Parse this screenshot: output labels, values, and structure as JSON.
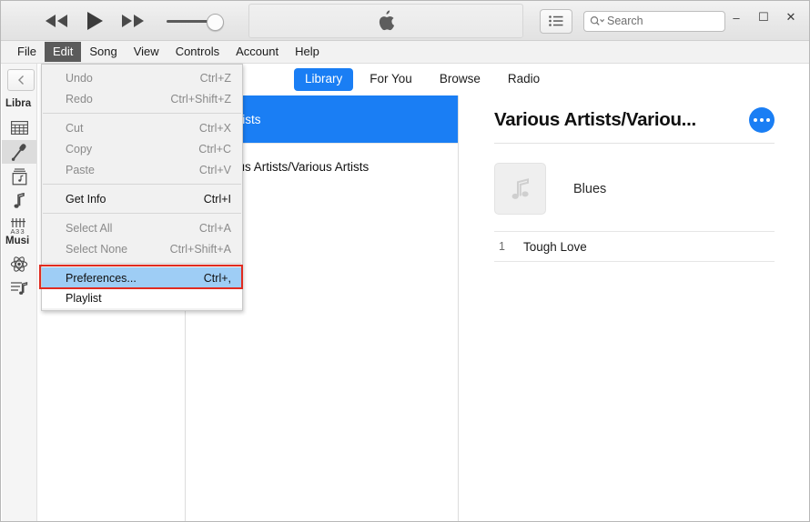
{
  "window": {
    "controls": {
      "minimize": "–",
      "maximize": "☐",
      "close": "✕"
    }
  },
  "toolbar": {
    "previous_icon": "rewind-icon",
    "play_icon": "play-icon",
    "next_icon": "fast-forward-icon",
    "volume_icon": "volume-slider",
    "airplay_icon": "airplay-icon",
    "apple_logo": "apple-logo",
    "list_view_icon": "list-view-icon",
    "search_placeholder": "Search",
    "search_value": "",
    "search_icon": "magnifier-icon"
  },
  "menubar": {
    "items": [
      {
        "label": "File",
        "active": false
      },
      {
        "label": "Edit",
        "active": true
      },
      {
        "label": "Song",
        "active": false
      },
      {
        "label": "View",
        "active": false
      },
      {
        "label": "Controls",
        "active": false
      },
      {
        "label": "Account",
        "active": false
      },
      {
        "label": "Help",
        "active": false
      }
    ]
  },
  "edit_menu": {
    "groups": [
      [
        {
          "label": "Undo",
          "accel": "Ctrl+Z",
          "enabled": false
        },
        {
          "label": "Redo",
          "accel": "Ctrl+Shift+Z",
          "enabled": false
        }
      ],
      [
        {
          "label": "Cut",
          "accel": "Ctrl+X",
          "enabled": false
        },
        {
          "label": "Copy",
          "accel": "Ctrl+C",
          "enabled": false
        },
        {
          "label": "Paste",
          "accel": "Ctrl+V",
          "enabled": false
        }
      ],
      [
        {
          "label": "Get Info",
          "accel": "Ctrl+I",
          "enabled": true
        }
      ],
      [
        {
          "label": "Select All",
          "accel": "Ctrl+A",
          "enabled": false
        },
        {
          "label": "Select None",
          "accel": "Ctrl+Shift+A",
          "enabled": false
        }
      ]
    ],
    "highlighted": {
      "label": "Preferences...",
      "accel": "Ctrl+,",
      "highlight_color": "#9ecdf5",
      "annotation_color": "#e02b20"
    },
    "below_label": "Playlist"
  },
  "sidebar": {
    "back_icon": "chevron-left-icon",
    "sections": [
      {
        "title": "Libra",
        "items": [
          {
            "icon": "grid-view-icon",
            "selected": false
          },
          {
            "icon": "microphone-artists-icon",
            "selected": true
          },
          {
            "icon": "album-icon",
            "selected": false
          },
          {
            "icon": "music-note-icon",
            "selected": false
          },
          {
            "icon": "genres-icon",
            "selected": false
          }
        ]
      },
      {
        "title": "Musi",
        "items": [
          {
            "icon": "genius-atom-icon",
            "selected": false
          },
          {
            "icon": "playlist-icon",
            "selected": false
          }
        ]
      }
    ]
  },
  "nav_tabs": [
    {
      "label": "Library",
      "active": true
    },
    {
      "label": "For You",
      "active": false
    },
    {
      "label": "Browse",
      "active": false
    },
    {
      "label": "Radio",
      "active": false
    }
  ],
  "artist_list": [
    {
      "label": "All Artists",
      "selected": true
    },
    {
      "label": "Various Artists/Various Artists",
      "selected": false
    }
  ],
  "detail": {
    "title": "Various Artists/Variou...",
    "more_button": "more-options-button",
    "album": {
      "art_icon": "music-note-placeholder-icon",
      "name": "Blues"
    },
    "tracks": [
      {
        "number": "1",
        "title": "Tough Love"
      }
    ]
  },
  "colors": {
    "accent_blue": "#1a7ef4",
    "menu_highlight": "#9ecdf5",
    "annotation_red": "#e02b20",
    "menu_active_bg": "#5b5b5b"
  }
}
